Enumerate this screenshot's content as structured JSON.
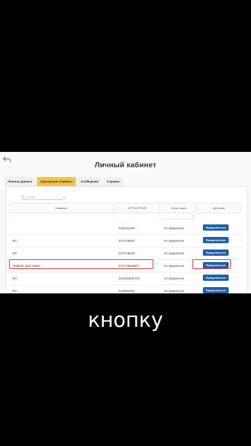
{
  "page": {
    "title": "Личный кабинет"
  },
  "tabs": [
    {
      "label": "Личные данные",
      "active": false
    },
    {
      "label": "Курьерские сервисы",
      "active": true
    },
    {
      "label": "Сообщения",
      "active": false
    },
    {
      "label": "Справка",
      "active": false
    }
  ],
  "search": {
    "placeholder": "Искать"
  },
  "table": {
    "headers": [
      "Название",
      "ОГРН/ОГРНИП",
      "Статус заказ",
      "Действия"
    ],
    "rows": [
      {
        "name": "",
        "inn": "3120312933",
        "status": "Не прикреплен",
        "action": "Прикрепиться"
      },
      {
        "name": "ИП",
        "inn": "3247148002",
        "status": "Не прикреплен",
        "action": "Прикрепиться"
      },
      {
        "name": "ИП",
        "inn": "3207148005",
        "status": "Не прикреплен",
        "action": "Прикрепиться"
      },
      {
        "name": "ЯНДЕКС.ДОСТАВКА",
        "inn": "3137748093877",
        "status": "Не прикреплен",
        "action": "Прикрепиться"
      },
      {
        "name": "ИП",
        "inn": "3112464031700",
        "status": "Не прикреплен",
        "action": "Прикрепиться"
      },
      {
        "name": "ИП",
        "inn": "3240810062",
        "status": "Не прикреплен",
        "action": "Прикрепиться"
      }
    ]
  },
  "caption": "кнопку",
  "colors": {
    "accent_tab": "#f6c344",
    "button": "#1f5fa8",
    "highlight": "#e03131"
  }
}
